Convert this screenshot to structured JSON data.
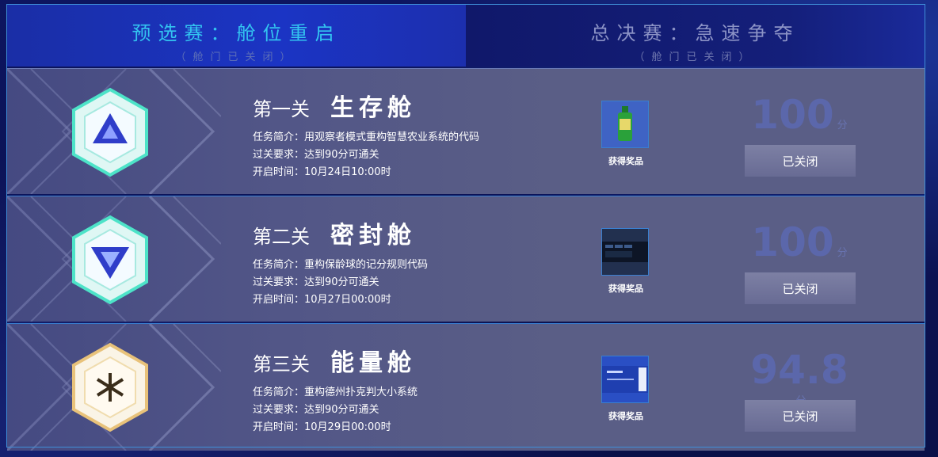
{
  "tabs": [
    {
      "title": "预选赛：舱位重启",
      "sub": "（舱门已关闭）",
      "active": true
    },
    {
      "title": "总决赛：急速争夺",
      "sub": "（舱门已关闭）",
      "active": false
    }
  ],
  "levels": [
    {
      "num": "第一关",
      "name": "生存舱",
      "intro_label": "任务简介：",
      "intro": "用观察者模式重构智慧农业系统的代码",
      "req_label": "过关要求：",
      "req": "达到90分可通关",
      "time_label": "开启时间：",
      "time": "10月24日10:00时",
      "prize_label": "获得奖品",
      "score": "100",
      "unit": "分",
      "button": "已关闭",
      "emblem_color": "#4de3c8"
    },
    {
      "num": "第二关",
      "name": "密封舱",
      "intro_label": "任务简介：",
      "intro": "重构保龄球的记分规则代码",
      "req_label": "过关要求：",
      "req": "达到90分可通关",
      "time_label": "开启时间：",
      "time": "10月27日00:00时",
      "prize_label": "获得奖品",
      "score": "100",
      "unit": "分",
      "button": "已关闭",
      "emblem_color": "#4de3c8"
    },
    {
      "num": "第三关",
      "name": "能量舱",
      "intro_label": "任务简介：",
      "intro": "重构德州扑克判大小系统",
      "req_label": "过关要求：",
      "req": "达到90分可通关",
      "time_label": "开启时间：",
      "time": "10月29日00:00时",
      "prize_label": "获得奖品",
      "score": "94.8",
      "unit": "分",
      "button": "已关闭",
      "emblem_color": "#e8c27a"
    }
  ]
}
